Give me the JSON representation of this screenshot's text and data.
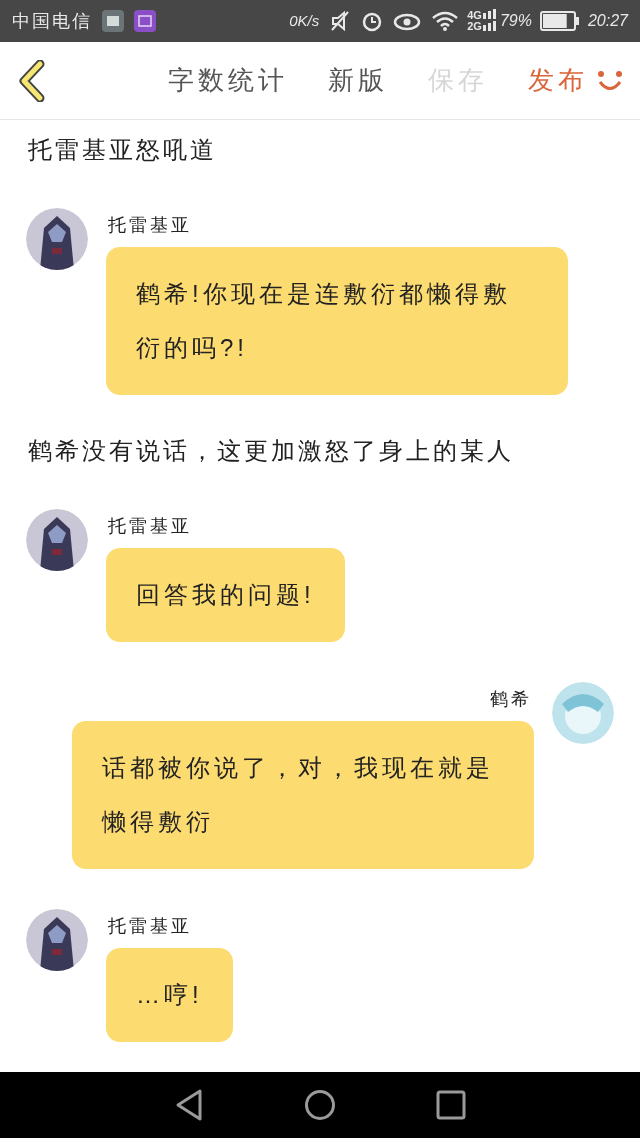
{
  "status_bar": {
    "carrier": "中国电信",
    "speed": "0K/s",
    "network_top": "4G",
    "network_bottom": "2G",
    "battery": "79%",
    "time": "20:27"
  },
  "header": {
    "actions": [
      {
        "label": "字数统计",
        "disabled": false,
        "accent": false
      },
      {
        "label": "新版",
        "disabled": false,
        "accent": false
      },
      {
        "label": "保存",
        "disabled": true,
        "accent": false
      },
      {
        "label": "发布",
        "disabled": false,
        "accent": true
      }
    ]
  },
  "story": [
    {
      "kind": "narration",
      "text": "托雷基亚怒吼道"
    },
    {
      "kind": "message",
      "outgoing": false,
      "speaker": "托雷基亚",
      "text": "鹤希!你现在是连敷衍都懒得敷衍的吗?!"
    },
    {
      "kind": "narration",
      "text": "鹤希没有说话，这更加激怒了身上的某人"
    },
    {
      "kind": "message",
      "outgoing": false,
      "speaker": "托雷基亚",
      "text": "回答我的问题!"
    },
    {
      "kind": "message",
      "outgoing": true,
      "speaker": "鹤希",
      "text": "话都被你说了，对，我现在就是懒得敷衍"
    },
    {
      "kind": "message",
      "outgoing": false,
      "speaker": "托雷基亚",
      "text": "…哼!"
    }
  ]
}
